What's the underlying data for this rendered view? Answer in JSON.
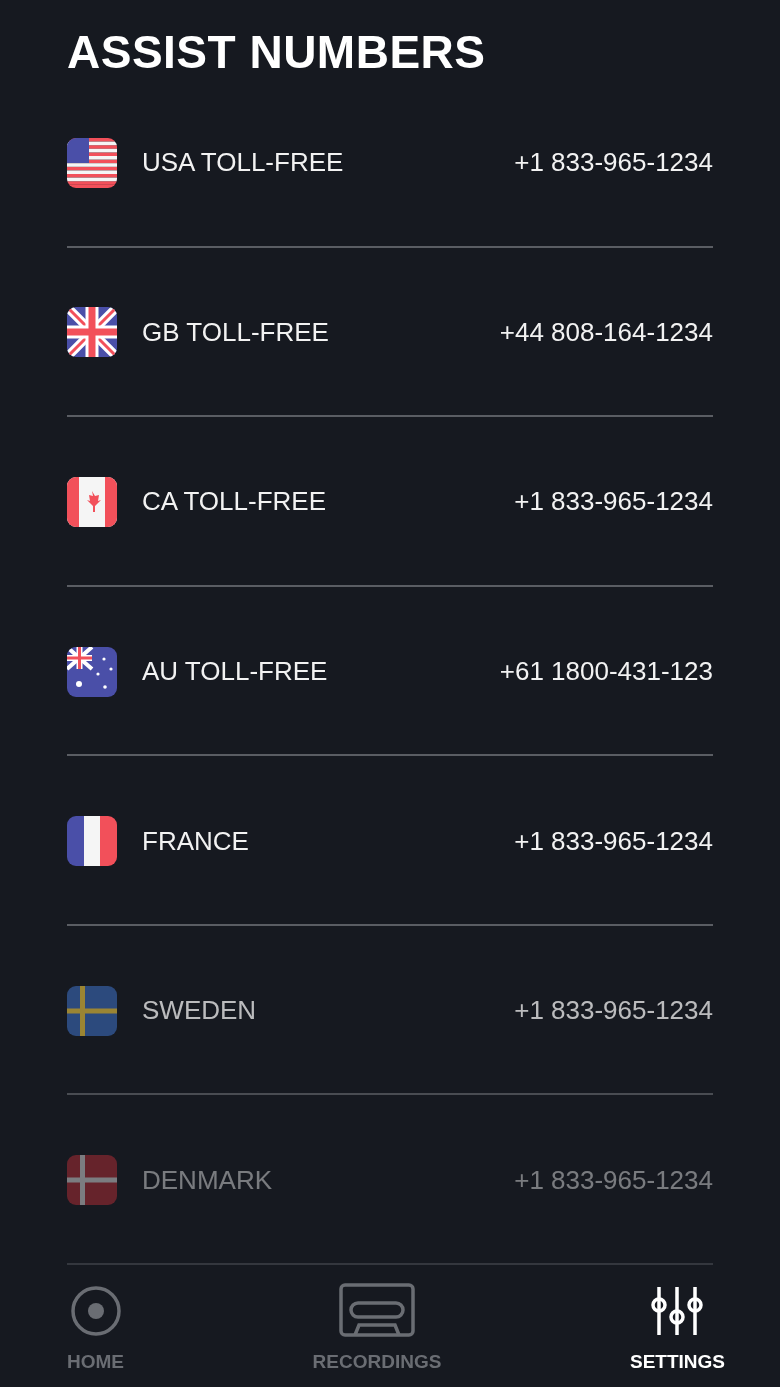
{
  "title": "ASSIST NUMBERS",
  "numbers": [
    {
      "label": "USA TOLL-FREE",
      "phone": "+1 833-965-1234"
    },
    {
      "label": "GB TOLL-FREE",
      "phone": "+44 808-164-1234"
    },
    {
      "label": "CA TOLL-FREE",
      "phone": "+1 833-965-1234"
    },
    {
      "label": "AU TOLL-FREE",
      "phone": "+61 1800-431-123"
    },
    {
      "label": "FRANCE",
      "phone": "+1 833-965-1234"
    },
    {
      "label": "SWEDEN",
      "phone": "+1 833-965-1234"
    },
    {
      "label": "DENMARK",
      "phone": "+1 833-965-1234"
    }
  ],
  "nav": [
    {
      "label": "HOME",
      "selected": false
    },
    {
      "label": "RECORDINGS",
      "selected": false
    },
    {
      "label": "SETTINGS",
      "selected": true
    }
  ]
}
